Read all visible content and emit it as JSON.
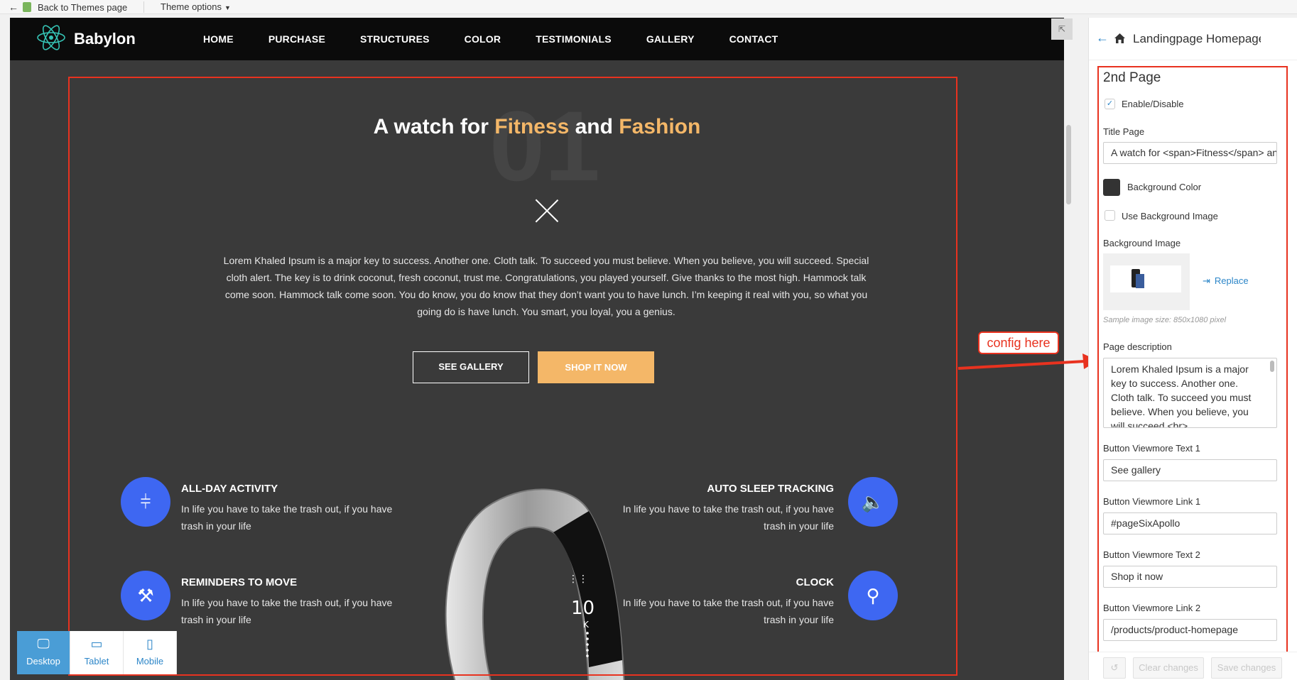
{
  "topbar": {
    "back_label": "Back to Themes page",
    "options_label": "Theme options"
  },
  "nav": {
    "brand": "Babylon",
    "menu": [
      "HOME",
      "PURCHASE",
      "STRUCTURES",
      "COLOR",
      "TESTIMONIALS",
      "GALLERY",
      "CONTACT"
    ]
  },
  "hero": {
    "number": "01",
    "title_1": "A watch for ",
    "title_acc1": "Fitness",
    "title_2": " and ",
    "title_acc2": "Fashion",
    "description": "Lorem Khaled Ipsum is a major key to success. Another one. Cloth talk. To succeed you must believe. When you believe, you will succeed. Special cloth alert. The key is to drink coconut, fresh coconut, trust me. Congratulations, you played yourself. Give thanks to the most high. Hammock talk come soon. Hammock talk come soon. You do know, you do know that they don’t want you to have lunch. I’m keeping it real with you, so what you going do is have lunch. You smart, you loyal, you a genius.",
    "btn_gallery": "SEE GALLERY",
    "btn_shop": "SHOP IT NOW"
  },
  "features": {
    "f1": {
      "title": "ALL-DAY ACTIVITY",
      "text": "In life you have to take the trash out, if you have trash in your life"
    },
    "f2": {
      "title": "REMINDERS TO MOVE",
      "text": "In life you have to take the trash out, if you have trash in your life"
    },
    "f3": {
      "title": "AUTO SLEEP TRACKING",
      "text": "In life you have to take the trash out, if you have trash in your life"
    },
    "f4": {
      "title": "CLOCK",
      "text": "In life you have to take the trash out, if you have trash in your life"
    }
  },
  "watch": {
    "display_number": "10",
    "display_unit": "K"
  },
  "devices": {
    "desktop": "Desktop",
    "tablet": "Tablet",
    "mobile": "Mobile"
  },
  "callout": "config here",
  "sidebar": {
    "header_title": "Landingpage Homepage",
    "section_title": "2nd Page",
    "enable_label": "Enable/Disable",
    "title_page_label": "Title Page",
    "title_page_value": "A watch for <span>Fitness</span> and <span>Fashion</span>",
    "bg_color_label": "Background Color",
    "use_bg_image_label": "Use Background Image",
    "bg_image_label": "Background Image",
    "replace_label": "Replace",
    "sample_size": "Sample image size: 850x1080 pixel",
    "page_desc_label": "Page description",
    "page_desc_value": "Lorem Khaled Ipsum is a major key to success. Another one. Cloth talk. To succeed you must believe. When you believe, you will succeed <br>",
    "btn_text1_label": "Button Viewmore Text 1",
    "btn_text1_value": "See gallery",
    "btn_link1_label": "Button Viewmore Link 1",
    "btn_link1_value": "#pageSixApollo",
    "btn_text2_label": "Button Viewmore Text 2",
    "btn_text2_value": "Shop it now",
    "btn_link2_label": "Button Viewmore Link 2",
    "btn_link2_value": "/products/product-homepage",
    "clear_label": "Clear changes",
    "save_label": "Save changes"
  },
  "colors": {
    "accent": "#f4b768",
    "icon_blue": "#3e67f2",
    "link_blue": "#2c86c8",
    "highlight_red": "#e8321f"
  }
}
